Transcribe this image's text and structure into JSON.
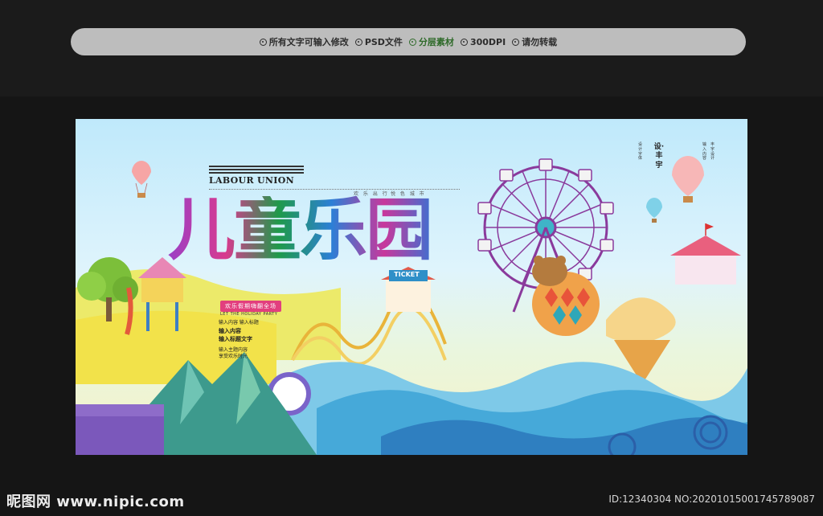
{
  "banner": {
    "features": [
      {
        "label": "所有文字可输入修改",
        "style": "normal"
      },
      {
        "label": "PSD文件",
        "style": "normal"
      },
      {
        "label": "分层素材",
        "style": "green"
      },
      {
        "label": "300DPI",
        "style": "normal"
      },
      {
        "label": "请勿转载",
        "style": "normal"
      }
    ]
  },
  "poster": {
    "labour_union": "LABOUR UNION",
    "title": "儿童乐园",
    "small_left": "欢 乐 出 行",
    "small_right": "悦 色 城 市",
    "subtitle_pill": "欢乐假期嗨翻全场",
    "subtitle_en": "LET THE HOLIDAY PARTY",
    "note1": "输入内容 输入标题",
    "note2": "输入内容",
    "note3": "输入标题文字",
    "note4": "输入主题内容",
    "note5": "享受欢乐时光",
    "ticket": "TICKET",
    "design_by": "设·丰宇",
    "tiny_col1": "设计字体",
    "tiny_col2": "输入内容",
    "tiny_col3": "丰宇设计"
  },
  "footer": {
    "logo": "昵图网 www.nipic.com",
    "id_text": "ID:12340304 NO:20201015001745789087"
  },
  "colors": {
    "background": "#151515",
    "banner": "#bdbdbd",
    "sky": "#bfe9fb",
    "title_purple": "#9b3fc6",
    "title_green": "#1f9a4a",
    "title_blue": "#2c7fd6",
    "accent_pink": "#e23f7e"
  }
}
